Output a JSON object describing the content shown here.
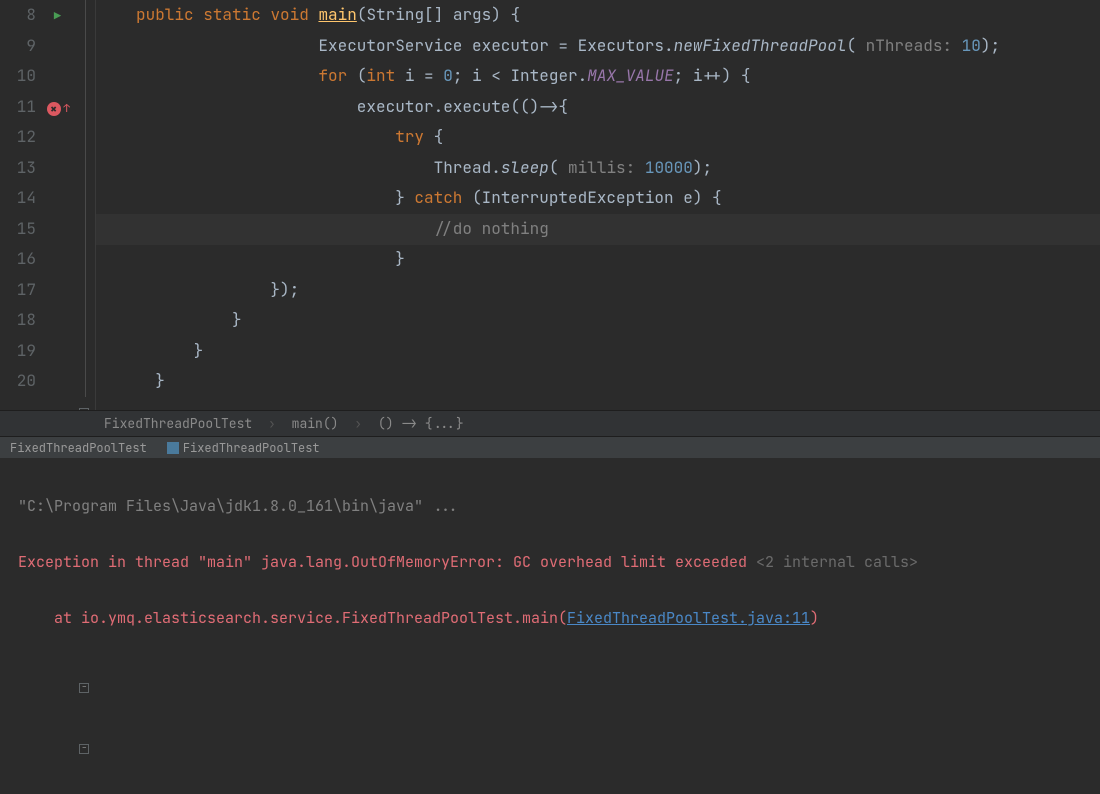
{
  "lines": {
    "8": {
      "num": "8"
    },
    "9": {
      "num": "9"
    },
    "10": {
      "num": "10"
    },
    "11": {
      "num": "11"
    },
    "12": {
      "num": "12"
    },
    "13": {
      "num": "13"
    },
    "14": {
      "num": "14"
    },
    "15": {
      "num": "15"
    },
    "16": {
      "num": "16"
    },
    "17": {
      "num": "17"
    },
    "18": {
      "num": "18"
    },
    "19": {
      "num": "19"
    },
    "20": {
      "num": "20"
    }
  },
  "code": {
    "l8_public": "public",
    "l8_static": "static",
    "l8_void": "void",
    "l8_main": "main",
    "l8_sig": "(String[] args) {",
    "l9_pre": "                   ExecutorService executor = Executors.",
    "l9_new": "newFixedThreadPool",
    "l9_pname": " nThreads: ",
    "l9_nval": "10",
    "l9_end": ");",
    "l10_pre": "                   ",
    "l10_for": "for",
    "l10_open": " (",
    "l10_int": "int",
    "l10_ieq": " i = ",
    "l10_zero": "0",
    "l10_semi": "; i < Integer.",
    "l10_mv": "MAX_VALUE",
    "l10_end": "; i++) {",
    "l11_pre": "                       executor.execute(()->{",
    "l12_pre": "                           ",
    "l12_try": "try",
    "l12_open": " {",
    "l13_pre": "                               Thread.",
    "l13_sleep": "sleep",
    "l13_open": "(",
    "l13_pname": " millis: ",
    "l13_nval": "10000",
    "l13_close": ");",
    "l14_pre": "                           } ",
    "l14_catch": "catch",
    "l14_rest": " (InterruptedException e) {",
    "l15_pre": "                               ",
    "l15_comment": "//do nothing",
    "l16": "                           }",
    "l17": "              });",
    "l18": "          }",
    "l19": "      }",
    "l20": "  }"
  },
  "breadcrumb": {
    "class": "FixedThreadPoolTest",
    "method": "main()",
    "lambda": "() -> {...}"
  },
  "tabs": {
    "t1": "FixedThreadPoolTest",
    "t2": "FixedThreadPoolTest"
  },
  "console": {
    "path": "\"C:\\Program Files\\Java\\jdk1.8.0_161\\bin\\java\" ...",
    "excPrefix": "Exception in thread \"main\" java.lang.",
    "excName": "OutOfMemoryError: GC overhead limit exceeded",
    "internal": "<2 internal calls>",
    "atPrefix": "    at io.ymq.elasticsearch.service.FixedThreadPoolTest.main",
    "linkOpen": "(",
    "link": "FixedThreadPoolTest.java:11",
    "linkClose": ")"
  }
}
